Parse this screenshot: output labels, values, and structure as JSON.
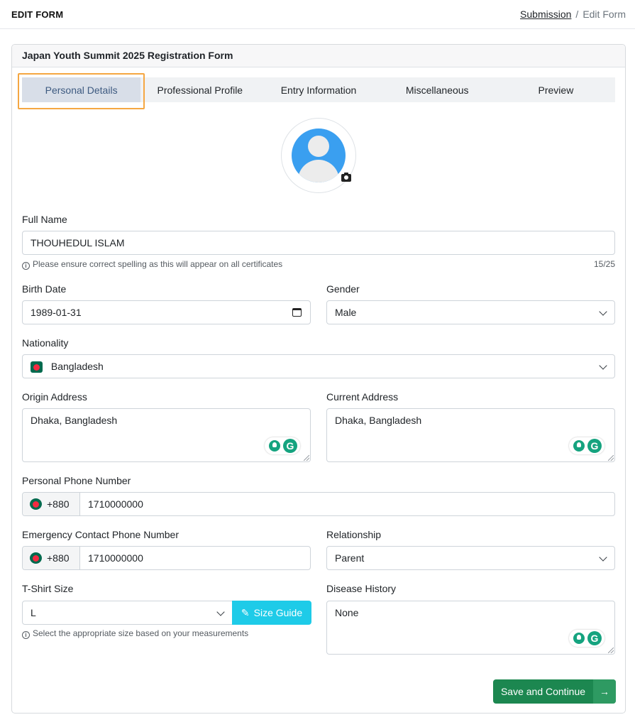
{
  "header": {
    "title": "EDIT FORM",
    "breadcrumb_link": "Submission",
    "breadcrumb_sep": "/",
    "breadcrumb_current": "Edit Form"
  },
  "form": {
    "title": "Japan Youth Summit 2025 Registration Form",
    "tabs": [
      "Personal Details",
      "Professional Profile",
      "Entry Information",
      "Miscellaneous",
      "Preview"
    ],
    "active_tab": "Personal Details",
    "full_name": {
      "label": "Full Name",
      "value": "THOUHEDUL ISLAM",
      "hint": "Please ensure correct spelling as this will appear on all certificates",
      "count": "15/25"
    },
    "birth_date": {
      "label": "Birth Date",
      "value": "1989-01-31"
    },
    "gender": {
      "label": "Gender",
      "value": "Male"
    },
    "nationality": {
      "label": "Nationality",
      "value": "Bangladesh"
    },
    "origin_address": {
      "label": "Origin Address",
      "value": "Dhaka, Bangladesh"
    },
    "current_address": {
      "label": "Current Address",
      "value": "Dhaka, Bangladesh"
    },
    "personal_phone": {
      "label": "Personal Phone Number",
      "code": "+880",
      "value": "1710000000"
    },
    "emergency_phone": {
      "label": "Emergency Contact Phone Number",
      "code": "+880",
      "value": "1710000000"
    },
    "relationship": {
      "label": "Relationship",
      "value": "Parent"
    },
    "tshirt": {
      "label": "T-Shirt Size",
      "value": "L",
      "guide_label": "Size Guide",
      "hint": "Select the appropriate size based on your measurements"
    },
    "disease_history": {
      "label": "Disease History",
      "value": "None"
    },
    "save_label": "Save and Continue",
    "save_arrow": "→"
  },
  "icons": {
    "avatar": "user-avatar-icon",
    "camera": "camera-icon",
    "calendar": "calendar-icon",
    "chevron": "chevron-down-icon",
    "flag": "bangladesh-flag-icon",
    "info": "info-icon",
    "pencil": "pencil-icon",
    "grammarly": "grammarly-icon"
  },
  "colors": {
    "accent_tab_highlight": "#f5a742",
    "active_tab_bg": "#d8dee8",
    "save_button": "#1c8750",
    "size_guide_button": "#1ecbe8"
  }
}
